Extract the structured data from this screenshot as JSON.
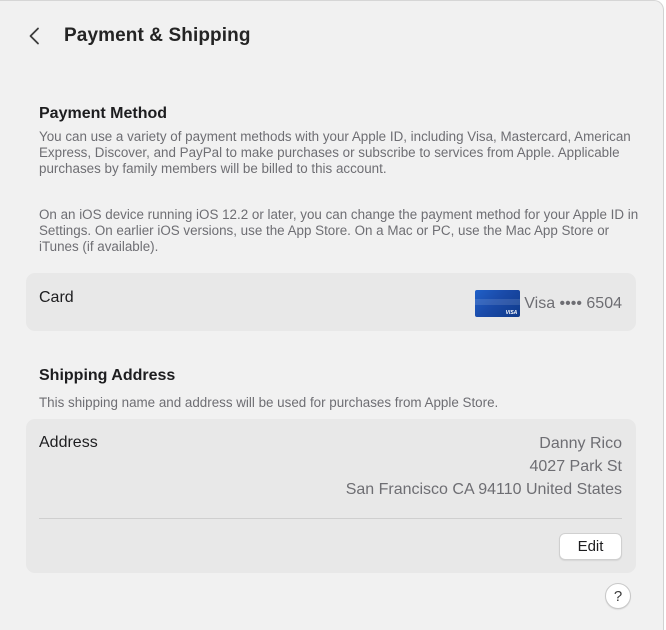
{
  "header": {
    "back_icon": "chevron-left-icon",
    "title": "Payment & Shipping"
  },
  "payment": {
    "title": "Payment Method",
    "desc_1": "You can use a variety of payment methods with your Apple ID, including Visa, Mastercard, American Express, Discover, and PayPal to make purchases or subscribe to services from Apple. Applicable purchases by family members will be billed to this account.",
    "desc_2": "On an iOS device running iOS 12.2 or later, you can change the payment method for your Apple ID in Settings. On earlier iOS versions, use the App Store. On a Mac or PC, use the Mac App Store or iTunes (if available).",
    "card_label": "Card",
    "card_icon": "visa-card-icon",
    "card_brand_logo": "VISA",
    "card_value": "Visa •••• 6504"
  },
  "shipping": {
    "title": "Shipping Address",
    "desc": "This shipping name and address will be used for purchases from Apple Store.",
    "address_label": "Address",
    "address_lines": [
      "Danny Rico",
      "4027 Park St",
      "San Francisco CA 94110 United States"
    ],
    "edit_label": "Edit"
  },
  "help": {
    "icon": "help-icon",
    "label": "?"
  }
}
